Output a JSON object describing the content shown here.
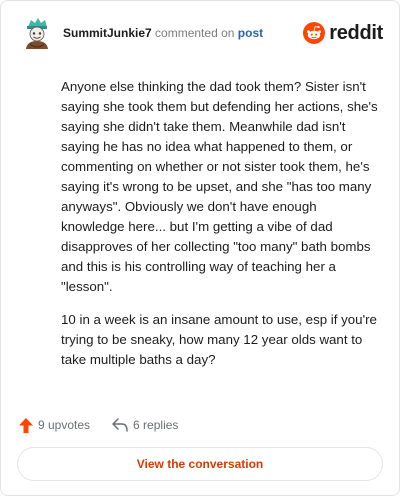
{
  "header": {
    "username": "SummitJunkie7",
    "action_text": "commented on",
    "link_text": "post",
    "brand": "reddit",
    "brand_color": "#ff4500",
    "avatar_icon": "snoo-avatar-icon"
  },
  "comment": {
    "paragraphs": [
      "Anyone else thinking the dad took them? Sister isn't saying she took them but defending her actions, she's saying she didn't take them. Meanwhile dad isn't saying he has no idea what happened to them, or commenting on whether or not sister took them, he's saying it's wrong to be upset, and she \"has too many anyways\". Obviously we don't have enough knowledge here... but I'm getting a vibe of dad disapproves of her collecting \"too many\" bath bombs and this is his controlling way of teaching her a \"lesson\".",
      "10 in a week is an insane amount to use, esp if you're trying to be sneaky, how many 12 year olds want to take multiple baths a day?"
    ]
  },
  "footer": {
    "upvotes": "9 upvotes",
    "replies": "6 replies",
    "upvote_color": "#ff4500"
  },
  "cta": {
    "label": "View the conversation"
  }
}
